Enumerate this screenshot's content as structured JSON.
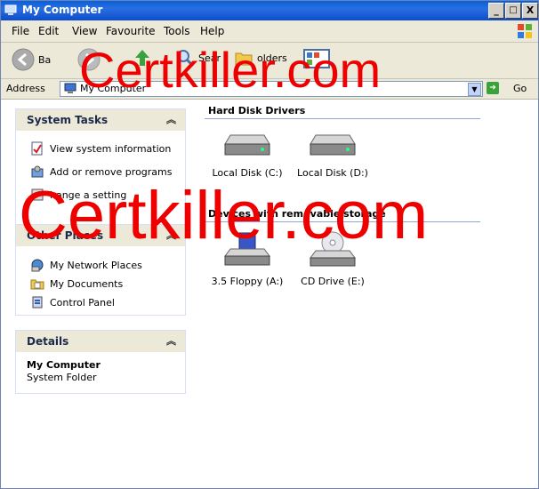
{
  "window": {
    "title": "My Computer"
  },
  "title_buttons": {
    "minimize": "_",
    "maximize": "□",
    "close": "X"
  },
  "menu": {
    "items": [
      "File",
      "Edit",
      "View",
      "Favourite",
      "Tools",
      "Help"
    ]
  },
  "toolbar": {
    "back_label": "Ba",
    "search_label": "Sear",
    "folders_label": "olders"
  },
  "address": {
    "label": "Address",
    "value": "My Computer",
    "go_label": "Go"
  },
  "left_panels": {
    "system_tasks": {
      "title": "System Tasks",
      "items": [
        "View system information",
        "Add or remove programs",
        "hange a setting"
      ]
    },
    "other_places": {
      "title": "Other Places",
      "items": [
        "My Network Places",
        "My Documents",
        "Control Panel"
      ]
    },
    "details": {
      "title": "Details",
      "name": "My Computer",
      "type": "System Folder"
    }
  },
  "groups": {
    "hard_disks": {
      "title": "Hard Disk Drivers",
      "drives": [
        "Local Disk (C:)",
        "Local Disk (D:)"
      ]
    },
    "removable": {
      "title": "Devices with removable storage",
      "drives": [
        "3.5 Floppy (A:)",
        "CD Drive (E:)"
      ]
    }
  },
  "watermark": {
    "text": "Certkiller.com"
  },
  "colors": {
    "titlebar": "#0a5fd8",
    "watermark": "#e00000",
    "panel_header": "#ece9d8"
  }
}
